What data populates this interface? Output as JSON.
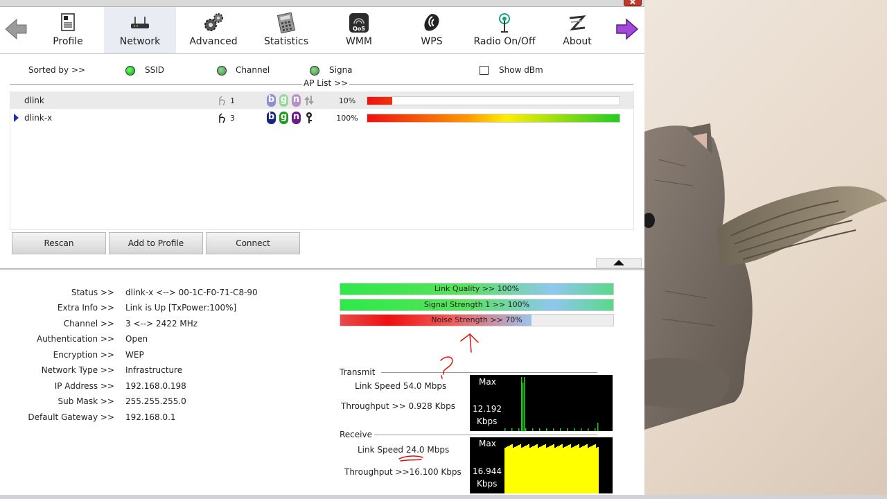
{
  "toolbar": {
    "items": [
      {
        "label": "Profile",
        "icon": "profile-icon"
      },
      {
        "label": "Network",
        "icon": "network-router-icon"
      },
      {
        "label": "Advanced",
        "icon": "gears-icon"
      },
      {
        "label": "Statistics",
        "icon": "calculator-icon"
      },
      {
        "label": "WMM",
        "icon": "qos-icon"
      },
      {
        "label": "WPS",
        "icon": "wps-icon"
      },
      {
        "label": "Radio On/Off",
        "icon": "radio-antenna-icon"
      },
      {
        "label": "About",
        "icon": "about-logo-icon"
      }
    ],
    "active": "Network"
  },
  "sort": {
    "label": "Sorted by >>",
    "options": [
      "SSID",
      "Channel",
      "Signa"
    ],
    "show_dbm": "Show dBm"
  },
  "ap_list": {
    "title": "AP List >>",
    "rows": [
      {
        "ssid": "dlink",
        "channel": "1",
        "signal": "10%",
        "signal_level": 0.1,
        "selected": false
      },
      {
        "ssid": "dlink-x",
        "channel": "3",
        "signal": "100%",
        "signal_level": 1.0,
        "selected": true
      }
    ],
    "badges": [
      "b",
      "g",
      "n"
    ]
  },
  "buttons": {
    "rescan": "Rescan",
    "add_profile": "Add to Profile",
    "connect": "Connect"
  },
  "status": {
    "rows": [
      {
        "label": "Status >>",
        "value": "dlink-x <--> 00-1C-F0-71-C8-90"
      },
      {
        "label": "Extra Info >>",
        "value": "Link is Up [TxPower:100%]"
      },
      {
        "label": "Channel >>",
        "value": "3 <--> 2422 MHz"
      },
      {
        "label": "Authentication >>",
        "value": "Open"
      },
      {
        "label": "Encryption >>",
        "value": "WEP"
      },
      {
        "label": "Network Type >>",
        "value": "Infrastructure"
      },
      {
        "label": "IP Address >>",
        "value": "192.168.0.198"
      },
      {
        "label": "Sub Mask >>",
        "value": "255.255.255.0"
      },
      {
        "label": "Default Gateway >>",
        "value": "192.168.0.1"
      }
    ]
  },
  "meters": [
    {
      "text": "Link Quality >> 100%",
      "level": 1.0
    },
    {
      "text": "Signal Strength 1 >> 100%",
      "level": 1.0
    },
    {
      "text": "Noise Strength >> 70%",
      "level": 0.7
    }
  ],
  "transmit": {
    "title": "Transmit",
    "link_speed": "Link Speed  54.0  Mbps",
    "throughput": "Throughput >> 0.928 Kbps",
    "graph_max": "Max",
    "graph_value": "12.192",
    "graph_unit": "Kbps"
  },
  "receive": {
    "title": "Receive",
    "link_speed": "Link Speed 24.0  Mbps",
    "throughput": "Throughput >>16.100 Kbps",
    "graph_max": "Max",
    "graph_value": "16.944",
    "graph_unit": "Kbps"
  },
  "colors": {
    "active_tab": "#e9ecf2",
    "meter_green": "#2ee84a",
    "meter_red": "#ee1111",
    "graph_tx": "#22cc22",
    "graph_rx": "#ffff00",
    "annotation": "#dd1111"
  }
}
